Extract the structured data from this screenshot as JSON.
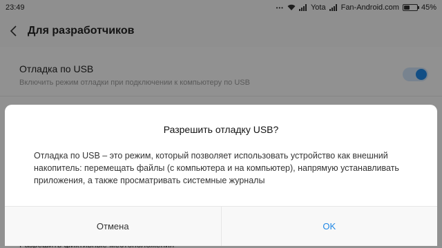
{
  "status": {
    "time": "23:49",
    "carrier": "Yota",
    "watermark": "Fan-Android.com",
    "battery": "45%",
    "battery_level": 0.45
  },
  "appbar": {
    "title": "Для разработчиков"
  },
  "settings": {
    "partial_row": "...",
    "usb_debug_title": "Отладка по USB",
    "usb_debug_desc": "Включить режим отладки при подключении к компьютеру по USB",
    "usb_debug_enabled": true,
    "bottom_row": "Разрешить фиктивные местоположения"
  },
  "dialog": {
    "title": "Разрешить отладку USB?",
    "message": "Отладка по USB – это режим, который позволяет использовать устройство как внешний накопитель: перемещать файлы (с компьютера и на компьютер), напрямую устанавливать приложения, а также просматривать системные журналы",
    "cancel_label": "Отмена",
    "ok_label": "OK"
  },
  "colors": {
    "accent": "#1e87e5"
  }
}
